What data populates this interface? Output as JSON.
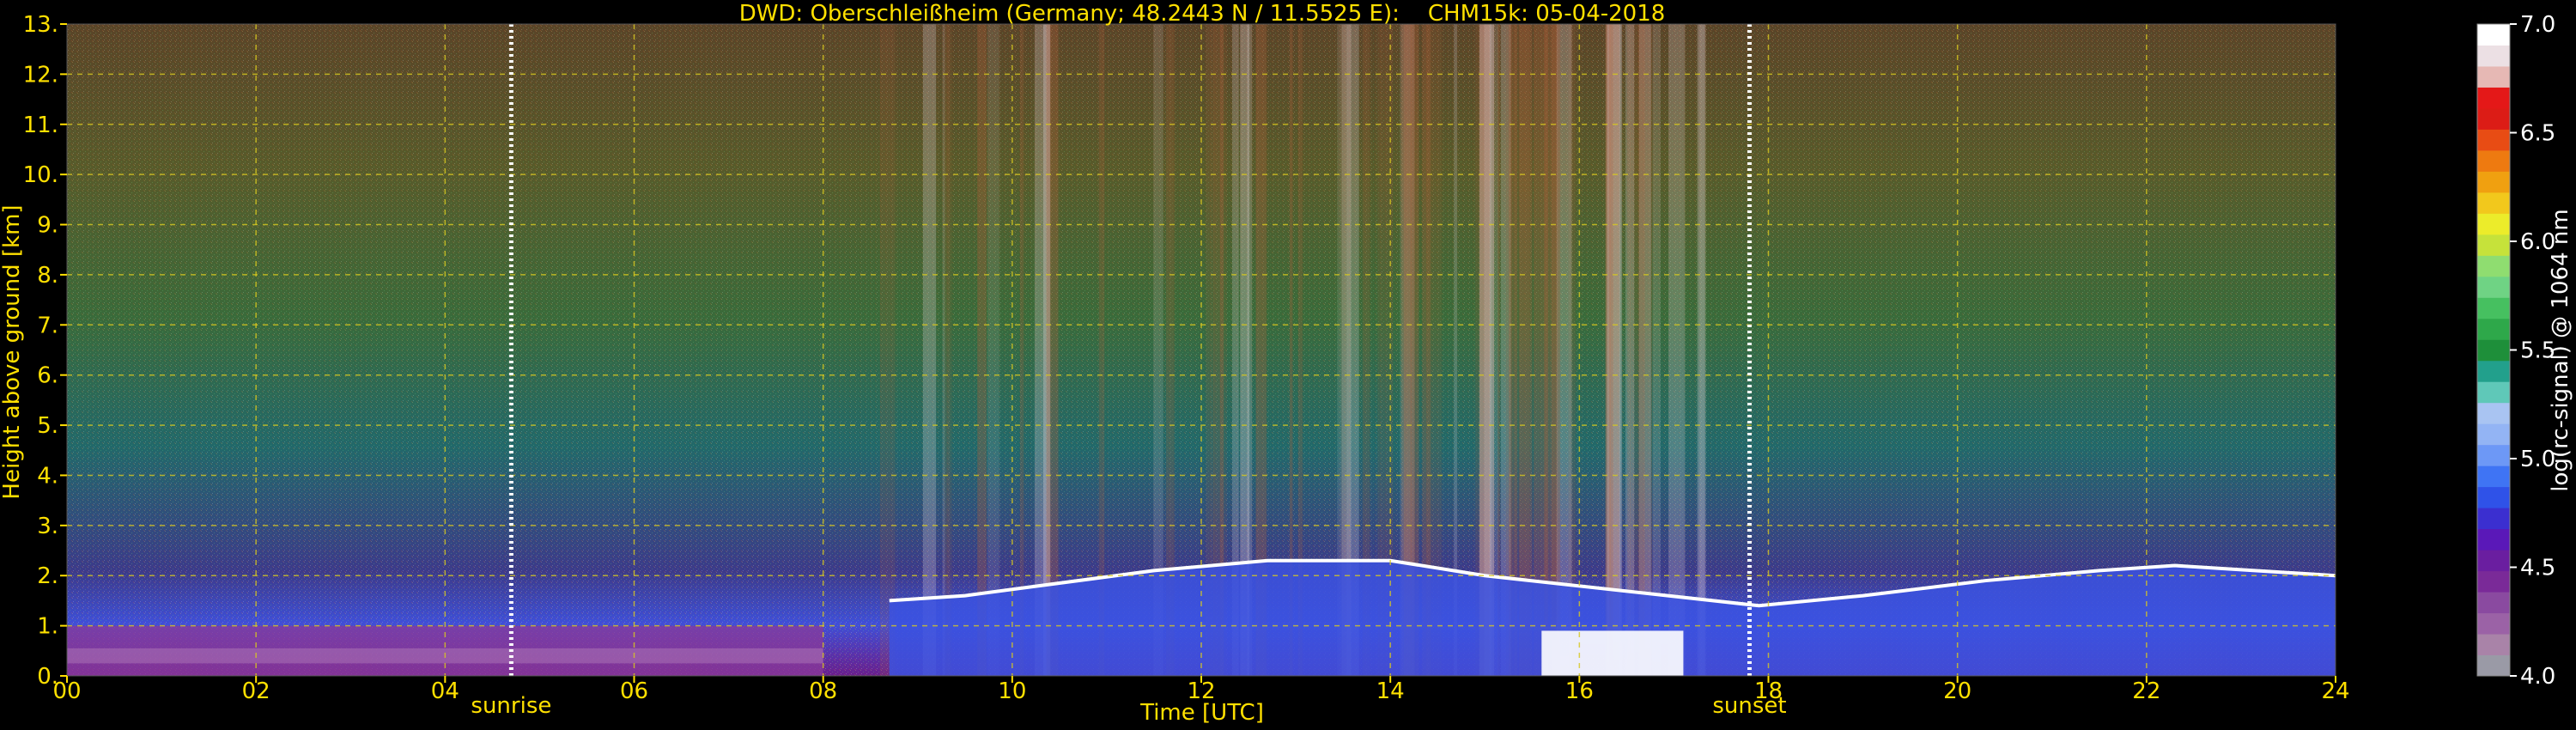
{
  "chart_data": {
    "type": "heatmap",
    "title": "DWD: Oberschleißheim (Germany; 48.2443 N / 11.5525 E):    CHM15k: 05-04-2018",
    "xlabel": "Time [UTC]",
    "ylabel": "Height above ground [km]",
    "xlim": [
      0,
      24
    ],
    "ylim": [
      0,
      13
    ],
    "x_ticks": [
      0,
      2,
      4,
      6,
      8,
      10,
      12,
      14,
      16,
      18,
      20,
      22,
      24
    ],
    "x_tick_labels": [
      "00",
      "02",
      "04",
      "06",
      "08",
      "10",
      "12",
      "14",
      "16",
      "18",
      "20",
      "22",
      "24"
    ],
    "y_ticks": [
      0,
      1,
      2,
      3,
      4,
      5,
      6,
      7,
      8,
      9,
      10,
      11,
      12,
      13
    ],
    "y_tick_labels": [
      "0.",
      "1.",
      "2.",
      "3.",
      "4.",
      "5.",
      "6.",
      "7.",
      "8.",
      "9.",
      "10.",
      "11.",
      "12.",
      "13."
    ],
    "grid": true,
    "colorbar": {
      "label": "log(rc-signal) @ 1064 nm",
      "range": [
        4.0,
        7.0
      ],
      "tick_values": [
        4.0,
        4.5,
        5.0,
        5.5,
        6.0,
        6.5,
        7.0
      ],
      "tick_labels": [
        "4.0",
        "4.5",
        "5.0",
        "5.5",
        "6.0",
        "6.5",
        "7.0"
      ],
      "colors": [
        "#9a9aa6",
        "#a983a8",
        "#9b62a6",
        "#8a4aa0",
        "#7a2a98",
        "#6a1ea0",
        "#5a18b8",
        "#3b2fd0",
        "#2f52e8",
        "#3f74f4",
        "#6d98f6",
        "#93b4f4",
        "#a9c4f2",
        "#5fc8b8",
        "#22a08c",
        "#1e8f3a",
        "#2ea84a",
        "#46c060",
        "#6fd384",
        "#8fdd70",
        "#c6e23a",
        "#ecec2a",
        "#f2c81c",
        "#f0a010",
        "#ee7a10",
        "#e84c14",
        "#dc1c16",
        "#e41818",
        "#e6b8b4",
        "#ece0e4",
        "#ffffff"
      ]
    },
    "annotations": [
      {
        "label": "sunrise",
        "x": 4.7
      },
      {
        "label": "sunset",
        "x": 17.8
      }
    ],
    "cloud_top_km": [
      {
        "t": 8.7,
        "h": 1.5
      },
      {
        "t": 9.5,
        "h": 1.6
      },
      {
        "t": 10.3,
        "h": 1.8
      },
      {
        "t": 11.5,
        "h": 2.1
      },
      {
        "t": 12.7,
        "h": 2.3
      },
      {
        "t": 14.0,
        "h": 2.3
      },
      {
        "t": 15.0,
        "h": 2.0
      },
      {
        "t": 17.9,
        "h": 1.4
      },
      {
        "t": 19.0,
        "h": 1.6
      },
      {
        "t": 20.3,
        "h": 1.9
      },
      {
        "t": 21.5,
        "h": 2.1
      },
      {
        "t": 22.3,
        "h": 2.2
      },
      {
        "t": 24.0,
        "h": 2.0
      }
    ]
  }
}
